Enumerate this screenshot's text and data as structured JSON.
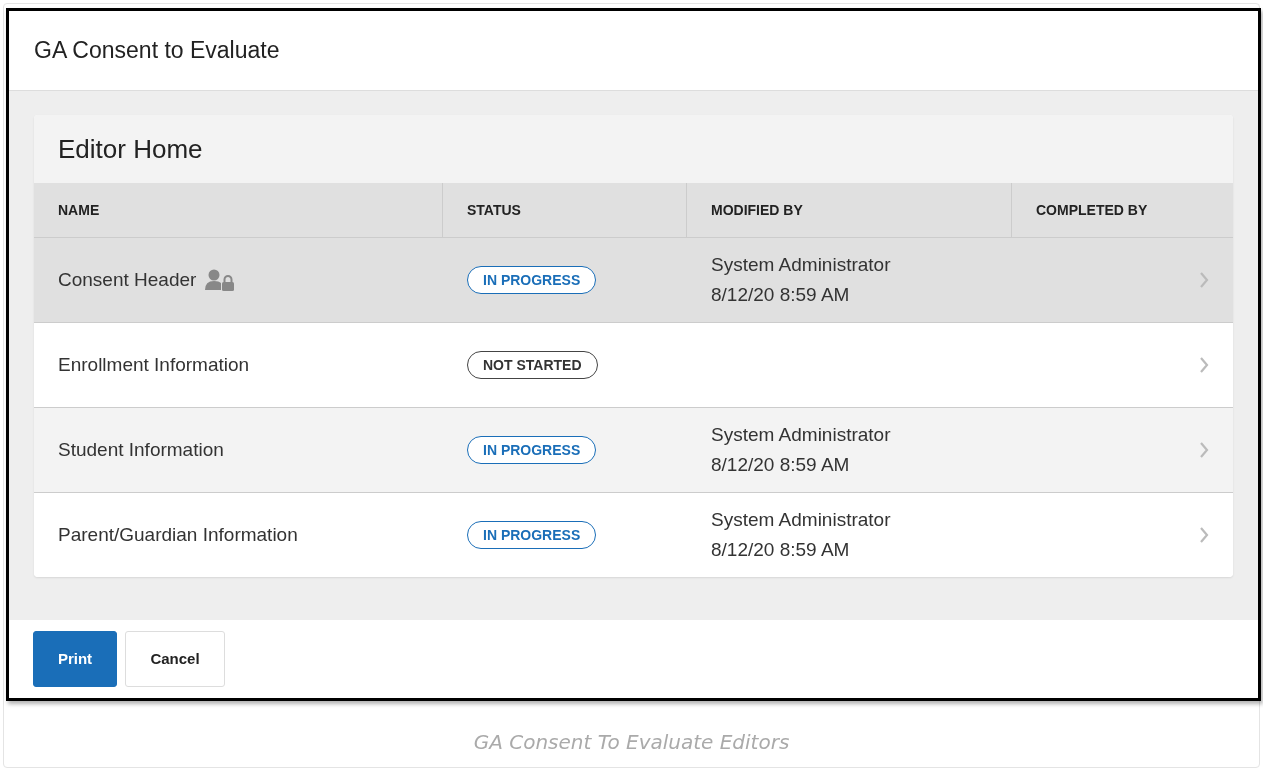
{
  "window": {
    "title": "GA Consent to Evaluate"
  },
  "panel": {
    "title": "Editor Home"
  },
  "table": {
    "columns": [
      "NAME",
      "STATUS",
      "MODIFIED BY",
      "COMPLETED BY"
    ],
    "rows": [
      {
        "name": "Consent Header",
        "locked": true,
        "status": {
          "kind": "in_progress",
          "label": "IN PROGRESS"
        },
        "modified_by": "System Administrator",
        "modified_at": "8/12/20 8:59 AM",
        "selected": true
      },
      {
        "name": "Enrollment Information",
        "locked": false,
        "status": {
          "kind": "not_started",
          "label": "NOT STARTED"
        },
        "selected": false
      },
      {
        "name": "Student Information",
        "locked": false,
        "status": {
          "kind": "in_progress",
          "label": "IN PROGRESS"
        },
        "modified_by": "System Administrator",
        "modified_at": "8/12/20 8:59 AM",
        "selected": false
      },
      {
        "name": "Parent/Guardian Information",
        "locked": false,
        "status": {
          "kind": "in_progress",
          "label": "IN PROGRESS"
        },
        "modified_by": "System Administrator",
        "modified_at": "8/12/20 8:59 AM",
        "selected": false
      }
    ]
  },
  "buttons": [
    {
      "label": "Print",
      "kind": "primary"
    },
    {
      "label": "Cancel",
      "kind": "secondary"
    }
  ],
  "caption": "GA Consent To Evaluate Editors"
}
